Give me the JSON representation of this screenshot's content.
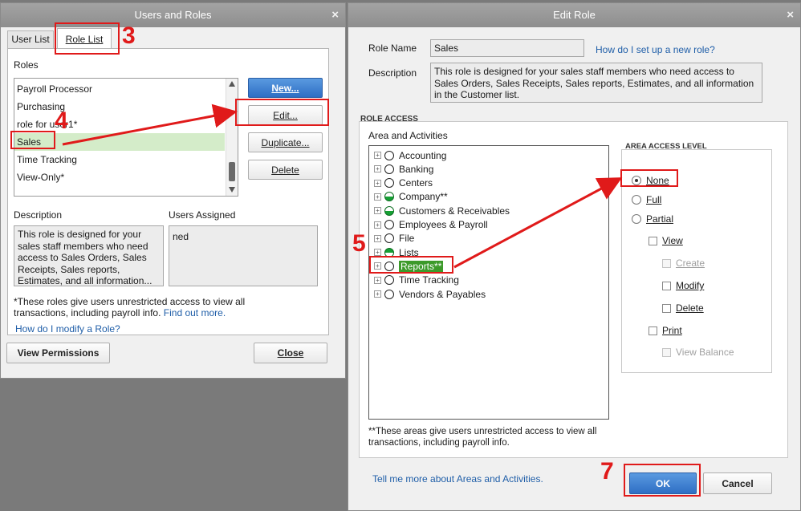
{
  "left_window": {
    "title": "Users and Roles",
    "close_glyph": "×",
    "tabs": [
      "User List",
      "Role List"
    ],
    "roles_label": "Roles",
    "roles": [
      "Payroll Processor",
      "Purchasing",
      "role for user1*",
      "Sales",
      "Time Tracking",
      "View-Only*"
    ],
    "selected_role": "Sales",
    "buttons": {
      "new": "New...",
      "edit": "Edit...",
      "duplicate": "Duplicate...",
      "delete": "Delete"
    },
    "description_label": "Description",
    "description_text": "This role is designed for your sales staff members who need access to Sales Orders, Sales Receipts, Sales reports, Estimates, and all information...",
    "users_assigned_label": "Users Assigned",
    "users_assigned": "ned",
    "note": "*These roles give users unrestricted access to view all transactions, including payroll info.",
    "find_out_more": "Find out more.",
    "modify_link": "How do I modify a Role?",
    "view_permissions": "View Permissions",
    "close_button": "Close"
  },
  "right_window": {
    "title": "Edit Role",
    "close_glyph": "×",
    "role_name_label": "Role Name",
    "role_name_value": "Sales",
    "setup_link": "How do I set up a new role?",
    "description_label": "Description",
    "description_value": "This role is designed for your sales staff members who need access to Sales Orders, Sales Receipts, Sales reports, Estimates, and all information in the Customer list.",
    "role_access_label": "ROLE ACCESS",
    "area_label": "Area and Activities",
    "areas": [
      "Accounting",
      "Banking",
      "Centers",
      "Company**",
      "Customers & Receivables",
      "Employees & Payroll",
      "File",
      "Lists",
      "Reports**",
      "Time Tracking",
      "Vendors & Payables"
    ],
    "selected_area": "Reports**",
    "areas_note": "**These areas give users unrestricted access to view all transactions, including payroll info.",
    "access_level_label": "AREA ACCESS LEVEL",
    "levels": {
      "none": "None",
      "full": "Full",
      "partial": "Partial"
    },
    "selected_level": "None",
    "permissions": {
      "view": "View",
      "create": "Create",
      "modify": "Modify",
      "delete": "Delete",
      "print": "Print",
      "view_balance": "View Balance"
    },
    "tell_more_link": "Tell me more about Areas and Activities.",
    "ok": "OK",
    "cancel": "Cancel"
  },
  "annotations": {
    "step3": "3",
    "step4": "4",
    "step5": "5",
    "step7": "7"
  },
  "colors": {
    "annotation": "#e01a1a",
    "selection": "#d4ecc9",
    "link": "#1f5ea8",
    "primary_button": "#2e6ec4"
  }
}
